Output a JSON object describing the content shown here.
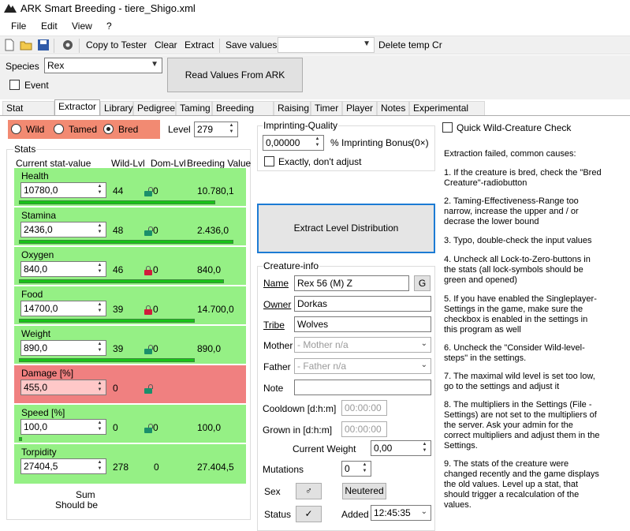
{
  "window": {
    "title": "ARK Smart Breeding - tiere_Shigo.xml"
  },
  "menu": [
    "File",
    "Edit",
    "View",
    "?"
  ],
  "toolbar": {
    "copy_to_tester": "Copy to Tester",
    "clear": "Clear",
    "extract": "Extract",
    "save_values": "Save values",
    "delete_temp": "Delete temp Cr"
  },
  "species": {
    "label": "Species",
    "value": "Rex"
  },
  "event": {
    "label": "Event",
    "checked": false
  },
  "read_values_button": "Read Values From ARK Window",
  "tabs": [
    "Stat Testing",
    "Extractor",
    "Library",
    "Pedigree",
    "Taming",
    "Breeding Plan",
    "Raising",
    "Timer",
    "Player",
    "Notes",
    "Experimental OCR"
  ],
  "active_tab": "Extractor",
  "origin": {
    "wild": "Wild",
    "tamed": "Tamed",
    "bred": "Bred",
    "selected": "Bred"
  },
  "level": {
    "label": "Level",
    "value": "279"
  },
  "stats": {
    "group_label": "Stats",
    "headers": {
      "current": "Current stat-value",
      "wild": "Wild-Lvl",
      "dom": "Dom-Lvl",
      "breeding": "Breeding Value"
    },
    "rows": [
      {
        "name": "Health",
        "value": "10780,0",
        "wild": "44",
        "dom": "0",
        "breeding": "10.780,1",
        "bar_fraction": 0.86,
        "lock": "unlocked",
        "status": "ok"
      },
      {
        "name": "Stamina",
        "value": "2436,0",
        "wild": "48",
        "dom": "0",
        "breeding": "2.436,0",
        "bar_fraction": 0.94,
        "lock": "unlocked",
        "status": "ok"
      },
      {
        "name": "Oxygen",
        "value": "840,0",
        "wild": "46",
        "dom": "0",
        "breeding": "840,0",
        "bar_fraction": 0.9,
        "lock": "locked",
        "status": "ok"
      },
      {
        "name": "Food",
        "value": "14700,0",
        "wild": "39",
        "dom": "0",
        "breeding": "14.700,0",
        "bar_fraction": 0.77,
        "lock": "locked",
        "status": "ok"
      },
      {
        "name": "Weight",
        "value": "890,0",
        "wild": "39",
        "dom": "0",
        "breeding": "890,0",
        "bar_fraction": 0.77,
        "lock": "unlocked",
        "status": "ok"
      },
      {
        "name": "Damage [%]",
        "value": "455,0",
        "wild": "0",
        "dom": "",
        "breeding": "",
        "bar_fraction": 0,
        "lock": "unlocked",
        "status": "error"
      },
      {
        "name": "Speed [%]",
        "value": "100,0",
        "wild": "0",
        "dom": "0",
        "breeding": "100,0",
        "bar_fraction": 0.01,
        "lock": "unlocked",
        "status": "ok"
      },
      {
        "name": "Torpidity",
        "value": "27404,5",
        "wild": "278",
        "dom": "0",
        "breeding": "27.404,5",
        "bar_fraction": 0,
        "lock": "none",
        "status": "ok"
      }
    ],
    "sum": "Sum",
    "should_be": "Should be"
  },
  "imprinting": {
    "group_label": "Imprinting-Quality",
    "value": "0,00000",
    "label": "% Imprinting Bonus",
    "extra": "(0×)",
    "exact_label": "Exactly, don't adjust"
  },
  "extract_button": "Extract Level Distribution",
  "creature_info": {
    "group_label": "Creature-info",
    "name_label": "Name",
    "name_value": "Rex 56 (M) Z",
    "g_button": "G",
    "owner_label": "Owner",
    "owner_value": "Dorkas",
    "tribe_label": "Tribe",
    "tribe_value": "Wolves",
    "mother_label": "Mother",
    "mother_value": "- Mother n/a",
    "father_label": "Father",
    "father_value": "- Father n/a",
    "note_label": "Note",
    "note_value": "",
    "cooldown_label": "Cooldown [d:h:m]",
    "cooldown_value": "00:00:00",
    "grown_label": "Grown in [d:h:m]",
    "grown_value": "00:00:00",
    "weight_label": "Current Weight",
    "weight_value": "0,00",
    "mutations_label": "Mutations",
    "mutations_value": "0",
    "sex_label": "Sex",
    "sex_value": "♂",
    "neutered_button": "Neutered",
    "status_label": "Status",
    "status_value": "✓",
    "added_label": "Added",
    "added_value": "12:45:35"
  },
  "quick_check": {
    "label": "Quick Wild-Creature Check",
    "checked": false
  },
  "help": {
    "heading": "Extraction failed, common causes:",
    "items": [
      "1. If the creature is bred, check the \"Bred Creature\"-radiobutton",
      "2. Taming-Effectiveness-Range too narrow, increase the upper and / or decrase the lower bound",
      "3. Typo, double-check the input values",
      "4. Uncheck all Lock-to-Zero-buttons in the stats (all lock-symbols should be green and opened)",
      "5. If you have enabled the Singleplayer-Settings in the game, make sure the checkbox is enabled in the settings in this program as well",
      "6. Uncheck the \"Consider Wild-level-steps\" in the settings.",
      "7. The maximal wild level is set too low, go to the settings and adjust it",
      "8. The multipliers in the Settings (File - Settings) are not set to the multipliers of the server. Ask your admin for the correct multipliers and adjust them in the Settings.",
      "9. The stats of the creature were changed recently and the game displays the old values. Level up a stat, that should trigger a recalculation of the values."
    ]
  },
  "colors": {
    "radio_bg": "#f28a72",
    "stat_ok": "#95f085",
    "stat_error": "#f08080",
    "bar": "#18c318",
    "lock_open": "#1a8f6b",
    "lock_closed": "#d01c3c",
    "accent": "#1c7bd4"
  }
}
